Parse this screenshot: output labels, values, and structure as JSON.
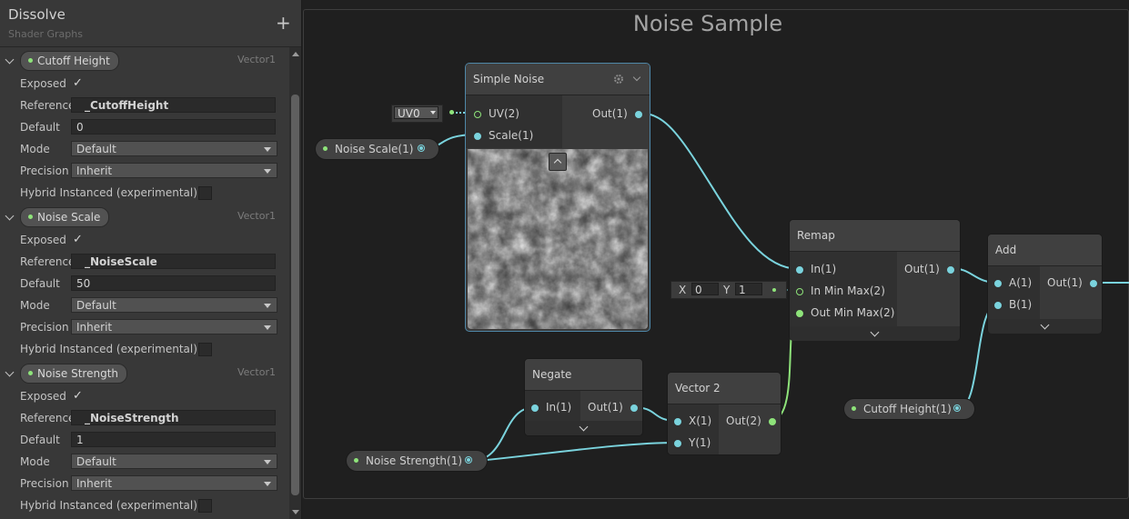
{
  "blackboard": {
    "title": "Dissolve",
    "subtitle": "Shader Graphs",
    "add_icon": "plus-icon",
    "labels": {
      "exposed": "Exposed",
      "reference": "Reference",
      "default": "Default",
      "mode": "Mode",
      "precision": "Precision",
      "hybrid": "Hybrid Instanced (experimental)"
    },
    "properties": [
      {
        "name": "Cutoff Height",
        "type": "Vector1",
        "exposed": true,
        "reference": "_CutoffHeight",
        "default": "0",
        "mode": "Default",
        "precision": "Inherit",
        "hybrid": false
      },
      {
        "name": "Noise Scale",
        "type": "Vector1",
        "exposed": true,
        "reference": "_NoiseScale",
        "default": "50",
        "mode": "Default",
        "precision": "Inherit",
        "hybrid": false
      },
      {
        "name": "Noise Strength",
        "type": "Vector1",
        "exposed": true,
        "reference": "_NoiseStrength",
        "default": "1",
        "mode": "Default",
        "precision": "Inherit",
        "hybrid": false
      }
    ]
  },
  "graph": {
    "group_title": "Noise Sample",
    "simple_noise": {
      "title": "Simple Noise",
      "inputs": [
        "UV(2)",
        "Scale(1)"
      ],
      "output": "Out(1)",
      "uv_value": "UV0"
    },
    "remap": {
      "title": "Remap",
      "inputs": [
        "In(1)",
        "In Min Max(2)",
        "Out Min Max(2)"
      ],
      "output": "Out(1)",
      "x_label": "X",
      "x_value": "0",
      "y_label": "Y",
      "y_value": "1"
    },
    "add": {
      "title": "Add",
      "inputs": [
        "A(1)",
        "B(1)"
      ],
      "output": "Out(1)"
    },
    "negate": {
      "title": "Negate",
      "inputs": [
        "In(1)"
      ],
      "output": "Out(1)"
    },
    "vector2": {
      "title": "Vector 2",
      "inputs": [
        "X(1)",
        "Y(1)"
      ],
      "output": "Out(2)"
    },
    "property_nodes": {
      "noise_scale": "Noise Scale(1)",
      "noise_strength": "Noise Strength(1)",
      "cutoff_height": "Cutoff Height(1)"
    }
  },
  "colors": {
    "wire": "#7ad3dd",
    "property_dot": "#8ee37a",
    "wire_vector2": "#8ee37a"
  }
}
